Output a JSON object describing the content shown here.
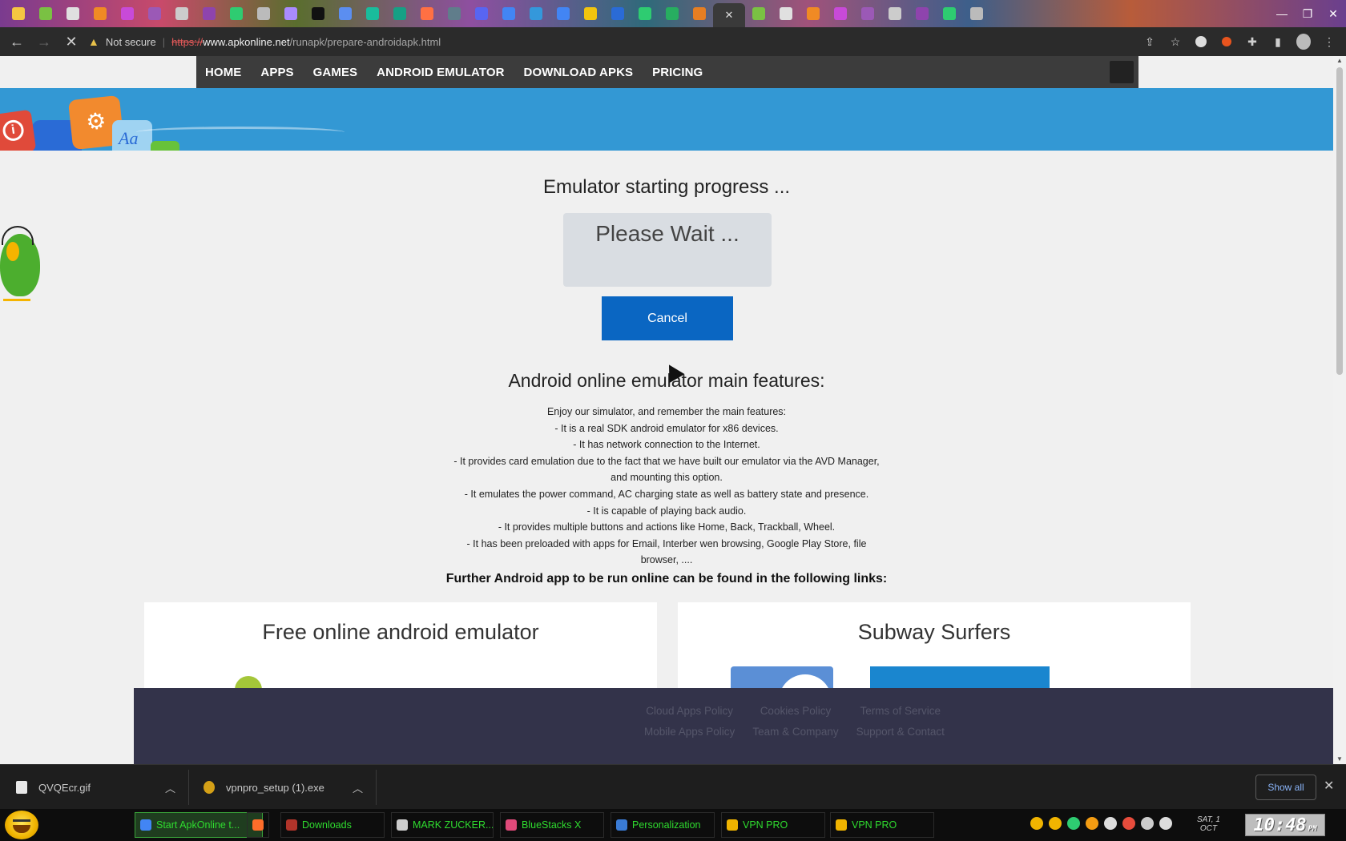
{
  "browser": {
    "tabs_count_visible": 36,
    "active_tab_close": "✕",
    "security_label": "Not secure",
    "url_protocol": "https://",
    "url_host": "www.apkonline.net",
    "url_path": "/runapk/prepare-androidapk.html",
    "icons": [
      "back-icon",
      "forward-icon",
      "stop-loading-icon",
      "share-icon",
      "bookmark-star-icon",
      "extension-icon",
      "puzzle-icon",
      "side-panel-icon",
      "profile-icon",
      "menu-icon"
    ]
  },
  "site_nav": {
    "items": [
      "HOME",
      "APPS",
      "GAMES",
      "ANDROID EMULATOR",
      "DOWNLOAD APKS",
      "PRICING"
    ]
  },
  "main": {
    "progress_title": "Emulator starting progress ...",
    "wait_text": "Please Wait ...",
    "cancel_label": "Cancel",
    "features_title": "Android online emulator main features:",
    "features_lines": [
      "Enjoy our simulator, and remember the main features:",
      "- It is a real SDK android emulator for x86 devices.",
      "- It has network connection to the Internet.",
      "- It provides card emulation due to the fact that we have built our emulator via the AVD Manager, and mounting this option.",
      "- It emulates the power command, AC charging state as well as battery state and presence.",
      "- It is capable of playing back audio.",
      "- It provides multiple buttons and actions like Home, Back, Trackball, Wheel.",
      "- It has been preloaded with apps for Email, Interber wen browsing, Google Play Store, file browser, ...."
    ],
    "further_links": "Further Android app to be run online can be found in the following links:",
    "cards": [
      "Free online android emulator",
      "Subway Surfers"
    ]
  },
  "footer": {
    "links": [
      "Cloud Apps Policy",
      "Cookies Policy",
      "Terms of Service",
      "Mobile Apps Policy",
      "Team & Company",
      "Support & Contact"
    ]
  },
  "downloads": {
    "items": [
      {
        "name": "QVQEcr.gif"
      },
      {
        "name": "vpnpro_setup (1).exe"
      }
    ],
    "show_all": "Show all",
    "close": "✕"
  },
  "taskbar": {
    "buttons": [
      {
        "label": "Start ApkOnline t...",
        "icon_color": "#4285f4",
        "active": true
      },
      {
        "label": "",
        "icon_color": "#ff6d2a",
        "active": false
      },
      {
        "label": "Downloads",
        "icon_color": "#b0342a",
        "active": false
      },
      {
        "label": "MARK ZUCKER...",
        "icon_color": "#cccccc",
        "active": false
      },
      {
        "label": "BlueStacks X",
        "icon_color": "#e04a7a",
        "active": false
      },
      {
        "label": "Personalization",
        "icon_color": "#3a7bd5",
        "active": false
      },
      {
        "label": "VPN PRO",
        "icon_color": "#f0b400",
        "active": false
      },
      {
        "label": "VPN PRO",
        "icon_color": "#f0b400",
        "active": false
      }
    ],
    "date_line1": "SAT, 1",
    "date_line2": "OCT",
    "time": "10:48",
    "ampm": "PM"
  }
}
